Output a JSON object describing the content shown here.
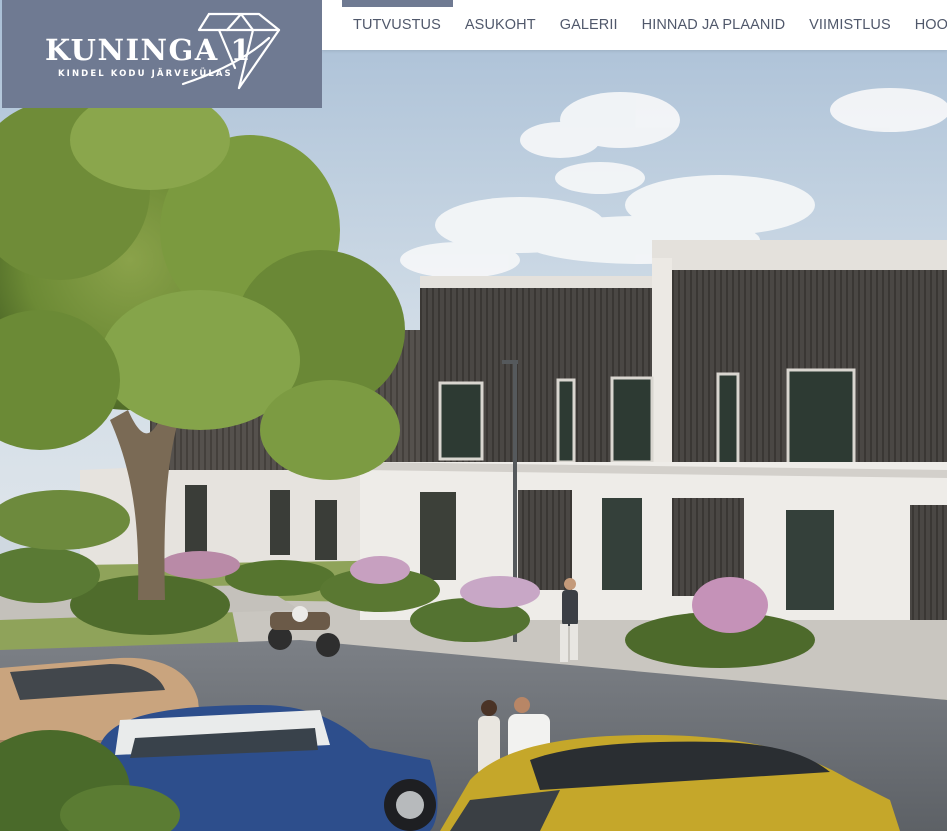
{
  "brand": {
    "name": "KUNINGA 1",
    "tagline": "KINDEL KODU JÄRVEKÜLAS",
    "logo_color": "#6f7a92",
    "icon": "diamond-icon"
  },
  "nav": {
    "items": [
      {
        "label": "TUTVUSTUS",
        "active": true
      },
      {
        "label": "ASUKOHT",
        "active": false
      },
      {
        "label": "GALERII",
        "active": false
      },
      {
        "label": "HINNAD JA PLAANID",
        "active": false
      },
      {
        "label": "VIIMISTLUS",
        "active": false
      },
      {
        "label": "HOONES",
        "active": false
      }
    ],
    "active_indicator_color": "#6f7a92",
    "text_color": "#50586b"
  },
  "hero": {
    "image": "residential-townhouse-render"
  }
}
